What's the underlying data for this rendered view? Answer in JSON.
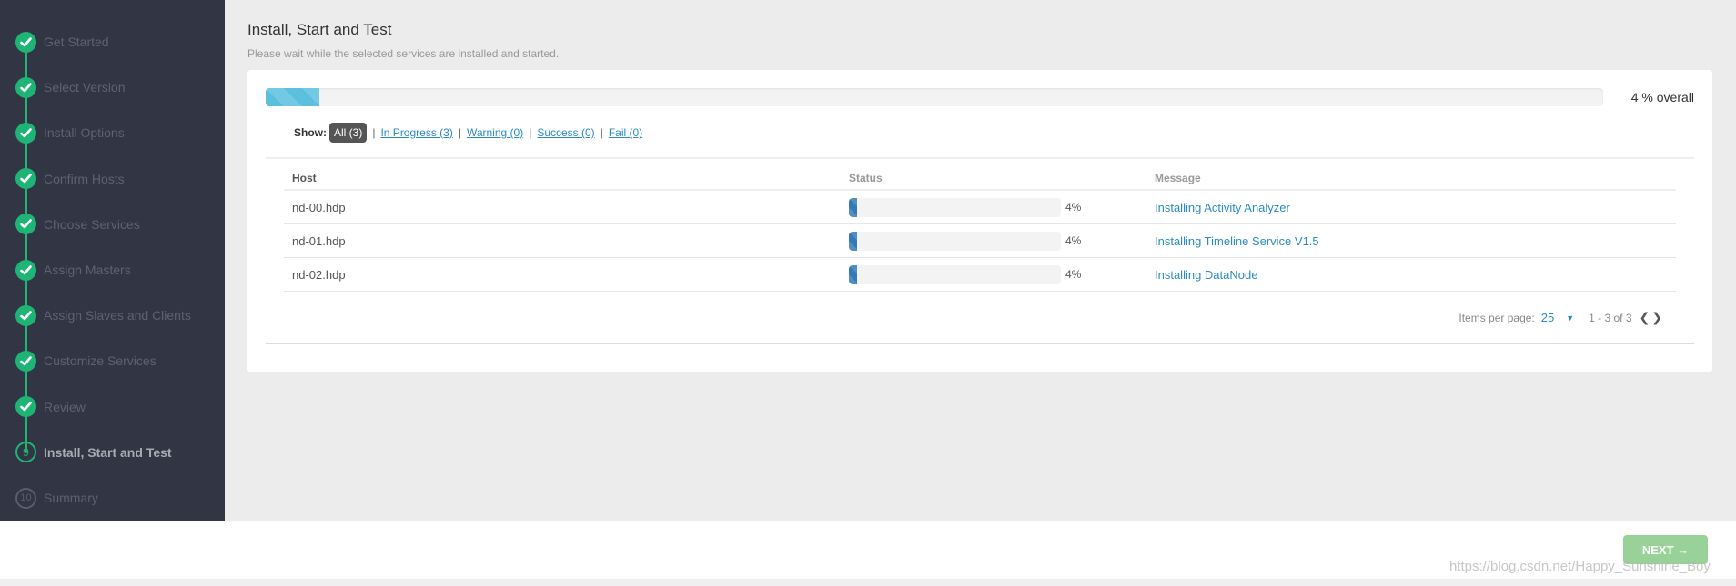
{
  "sidebar": {
    "steps": [
      {
        "label": "Get Started",
        "state": "done",
        "marker": "check"
      },
      {
        "label": "Select Version",
        "state": "done",
        "marker": "check"
      },
      {
        "label": "Install Options",
        "state": "done",
        "marker": "check"
      },
      {
        "label": "Confirm Hosts",
        "state": "done",
        "marker": "check"
      },
      {
        "label": "Choose Services",
        "state": "done",
        "marker": "check"
      },
      {
        "label": "Assign Masters",
        "state": "done",
        "marker": "check"
      },
      {
        "label": "Assign Slaves and Clients",
        "state": "done",
        "marker": "check"
      },
      {
        "label": "Customize Services",
        "state": "done",
        "marker": "check"
      },
      {
        "label": "Review",
        "state": "done",
        "marker": "check"
      },
      {
        "label": "Install, Start and Test",
        "state": "current",
        "marker": "9"
      },
      {
        "label": "Summary",
        "state": "pending",
        "marker": "10"
      }
    ]
  },
  "header": {
    "title": "Install, Start and Test",
    "subtitle": "Please wait while the selected services are installed and started."
  },
  "overall": {
    "progress_percent": 4,
    "label": "4 % overall"
  },
  "filters": {
    "show_label": "Show:",
    "items": [
      {
        "label": "All (3)",
        "active": true
      },
      {
        "label": "In Progress (3)",
        "active": false
      },
      {
        "label": "Warning (0)",
        "active": false
      },
      {
        "label": "Success (0)",
        "active": false
      },
      {
        "label": "Fail (0)",
        "active": false
      }
    ],
    "separator": "|"
  },
  "table": {
    "columns": [
      "Host",
      "Status",
      "Message"
    ],
    "rows": [
      {
        "host": "nd-00.hdp",
        "progress_percent": 4,
        "progress_label": "4%",
        "message": "Installing Activity Analyzer"
      },
      {
        "host": "nd-01.hdp",
        "progress_percent": 4,
        "progress_label": "4%",
        "message": "Installing Timeline Service V1.5"
      },
      {
        "host": "nd-02.hdp",
        "progress_percent": 4,
        "progress_label": "4%",
        "message": "Installing DataNode"
      }
    ]
  },
  "pagination": {
    "items_per_page_label": "Items per page:",
    "items_per_page": "25",
    "caret": "▼",
    "range": "1 - 3 of 3",
    "prev": "❮",
    "next": "❯"
  },
  "footer": {
    "next_label": "NEXT →",
    "watermark": "https://blog.csdn.net/Happy_Sunshine_Boy"
  },
  "colors": {
    "sidebar_bg": "#323544",
    "step_done": "#1eb475",
    "overall_progress": "#5bc0de",
    "host_progress": "#337ab7",
    "link": "#2a8bc2",
    "next_button": "#98d298"
  }
}
